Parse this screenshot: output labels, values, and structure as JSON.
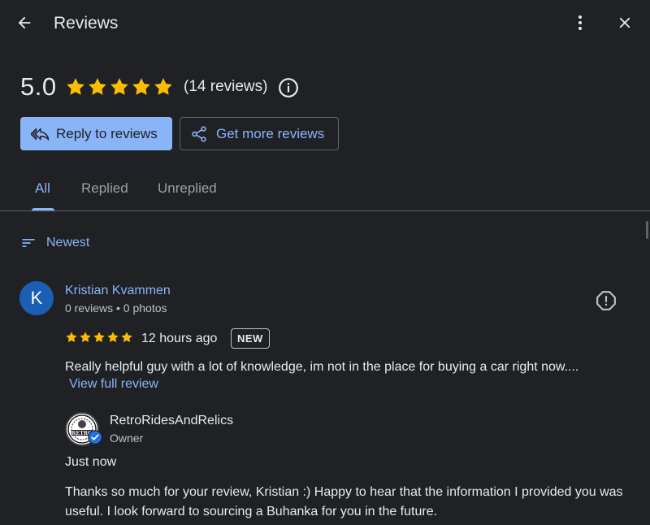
{
  "header": {
    "title": "Reviews",
    "back_icon": "arrow-left-icon",
    "menu_icon": "more-vert-icon",
    "close_icon": "close-icon"
  },
  "summary": {
    "rating": "5.0",
    "stars": 5,
    "count_text": "(14 reviews)",
    "info_icon": "info-icon"
  },
  "actions": {
    "reply_label": "Reply to reviews",
    "get_more_label": "Get more reviews"
  },
  "tabs": [
    {
      "label": "All",
      "active": true
    },
    {
      "label": "Replied",
      "active": false
    },
    {
      "label": "Unreplied",
      "active": false
    }
  ],
  "sort": {
    "label": "Newest"
  },
  "review": {
    "avatar_letter": "K",
    "name": "Kristian Kvammen",
    "meta": "0 reviews • 0 photos",
    "stars": 5,
    "time": "12 hours ago",
    "badge": "NEW",
    "text": "Really helpful guy with a lot of knowledge, im not in the place for buying a car right now....",
    "view_full": "View full review",
    "reply": {
      "owner_name": "RetroRidesAndRelics",
      "owner_label": "Owner",
      "logo_text": "RETRO",
      "time": "Just now",
      "text": "Thanks so much for your review, Kristian :) Happy to hear that the information I provided you was useful. I look forward to sourcing a Buhanka for you in the future."
    }
  },
  "colors": {
    "background": "#202124",
    "accent": "#8ab4f8",
    "star": "#fbbc04",
    "avatar": "#1a5fb4",
    "verified": "#1a73e8"
  }
}
